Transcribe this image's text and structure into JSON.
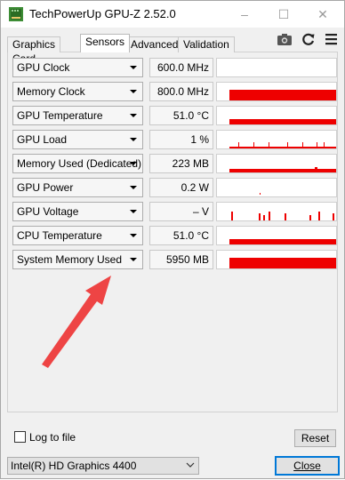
{
  "window": {
    "title": "TechPowerUp GPU-Z 2.52.0",
    "controls": {
      "minimize": "–",
      "maximize": "☐",
      "close": "✕"
    }
  },
  "tabs": [
    {
      "label": "Graphics Card",
      "active": false
    },
    {
      "label": "Sensors",
      "active": true
    },
    {
      "label": "Advanced",
      "active": false
    },
    {
      "label": "Validation",
      "active": false
    }
  ],
  "toolbar": {
    "icons": [
      "camera-icon",
      "refresh-icon",
      "menu-icon"
    ]
  },
  "sensors": [
    {
      "name": "GPU Clock",
      "value": "600.0 MHz",
      "graph": "none"
    },
    {
      "name": "Memory Clock",
      "value": "800.0 MHz",
      "graph": "full"
    },
    {
      "name": "GPU Temperature",
      "value": "51.0 °C",
      "graph": "mid"
    },
    {
      "name": "GPU Load",
      "value": "1 %",
      "graph": "sparse"
    },
    {
      "name": "Memory Used (Dedicated)",
      "value": "223 MB",
      "graph": "low"
    },
    {
      "name": "GPU Power",
      "value": "0.2 W",
      "graph": "dot"
    },
    {
      "name": "GPU Voltage",
      "value": "– V",
      "graph": "spikes"
    },
    {
      "name": "CPU Temperature",
      "value": "51.0 °C",
      "graph": "mid"
    },
    {
      "name": "System Memory Used",
      "value": "5950 MB",
      "graph": "full"
    }
  ],
  "footer": {
    "log_label": "Log to file",
    "log_checked": false,
    "reset_label": "Reset",
    "gpu_selected": "Intel(R) HD Graphics 4400",
    "close_label": "Close"
  },
  "colors": {
    "graph": "#ee0000",
    "arrow": "#ee4444",
    "accent": "#0078d7"
  }
}
